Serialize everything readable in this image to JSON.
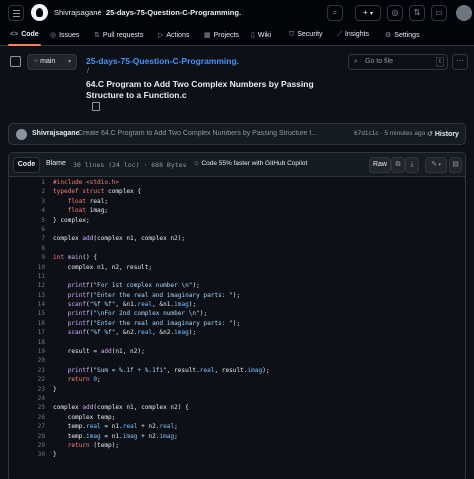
{
  "header": {
    "owner": "Shivrajsagane",
    "separator": "/",
    "repo": "25-days-75-Question-C-Programming.",
    "plus_label": "+",
    "icons": [
      "hamburger-icon",
      "github-logo",
      "search-icon",
      "plus-icon",
      "chevron-down-icon",
      "issues-icon",
      "pull-requests-icon",
      "inbox-icon",
      "avatar"
    ]
  },
  "tabs": [
    {
      "label": "Code",
      "icon": "code-icon"
    },
    {
      "label": "Issues",
      "icon": "issue-icon"
    },
    {
      "label": "Pull requests",
      "icon": "pull-request-icon"
    },
    {
      "label": "Actions",
      "icon": "play-icon"
    },
    {
      "label": "Projects",
      "icon": "table-icon"
    },
    {
      "label": "Wiki",
      "icon": "book-icon"
    },
    {
      "label": "Security",
      "icon": "shield-icon"
    },
    {
      "label": "Insights",
      "icon": "graph-icon"
    },
    {
      "label": "Settings",
      "icon": "gear-icon"
    }
  ],
  "file_nav": {
    "branch": "main",
    "repo_link": "25-days-75-Question-C-Programming.",
    "path_separator": "/",
    "file_name": "64.C Program to Add Two Complex Numbers by Passing Structure to a Function.c",
    "goto_placeholder": "Go to file",
    "goto_key": "t",
    "more": "···"
  },
  "commit": {
    "author": "Shivrajsagane",
    "message": "Create 64.C Program to Add Two Complex Numbers by Passing Structure t...",
    "hash_time": "67d1c1c · 5 minutes ago",
    "history_label": "History"
  },
  "file_header": {
    "code_tab": "Code",
    "blame_tab": "Blame",
    "meta": "30 lines (24 loc) · 688 Bytes",
    "copilot": "Code 55% faster with GitHub Copilot",
    "raw": "Raw"
  },
  "accent_colors": {
    "link": "#4493f8",
    "tab_underline": "#f78166",
    "keyword": "#ff7b72",
    "string": "#a5d6ff",
    "function": "#d2a8ff"
  },
  "code_lines": [
    "#include <stdio.h>",
    "typedef struct complex {",
    "    float real;",
    "    float imag;",
    "} complex;",
    "",
    "complex add(complex n1, complex n2);",
    "",
    "int main() {",
    "    complex n1, n2, result;",
    "",
    "    printf(\"For 1st complex number \\n\");",
    "    printf(\"Enter the real and imaginary parts: \");",
    "    scanf(\"%f %f\", &n1.real, &n1.imag);",
    "    printf(\"\\nFor 2nd complex number \\n\");",
    "    printf(\"Enter the real and imaginary parts: \");",
    "    scanf(\"%f %f\", &n2.real, &n2.imag);",
    "",
    "    result = add(n1, n2);",
    "",
    "    printf(\"Sum = %.1f + %.1fi\", result.real, result.imag);",
    "    return 0;",
    "}",
    "",
    "complex add(complex n1, complex n2) {",
    "    complex temp;",
    "    temp.real = n1.real + n2.real;",
    "    temp.imag = n1.imag + n2.imag;",
    "    return (temp);",
    "}"
  ]
}
